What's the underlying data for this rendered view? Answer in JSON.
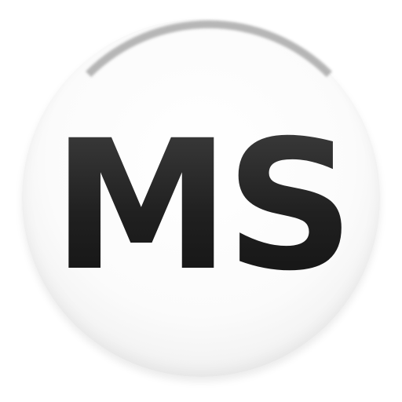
{
  "logo": {
    "text": "MS",
    "text_color": "#222222",
    "badge_color": "#ffffff",
    "rim_color": "#9a9a9a"
  }
}
